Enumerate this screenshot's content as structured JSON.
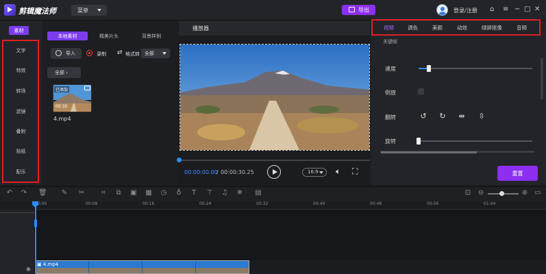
{
  "app": {
    "title": "剪辑魔法师",
    "menu_label": "菜单",
    "export_label": "导出",
    "login_label": "登录/注册"
  },
  "window_controls": {
    "home": "⌂",
    "menu": "≡",
    "minimize": "−",
    "maximize": "□",
    "close": "✕"
  },
  "sidebar": {
    "tag": "素材",
    "items": [
      {
        "label": "文字"
      },
      {
        "label": "特效"
      },
      {
        "label": "转场"
      },
      {
        "label": "滤镜"
      },
      {
        "label": "叠附"
      },
      {
        "label": "贴纸"
      },
      {
        "label": "配乐"
      }
    ]
  },
  "library": {
    "tabs": [
      {
        "label": "本地素材",
        "active": true
      },
      {
        "label": "精美片头",
        "active": false
      },
      {
        "label": "背景样例",
        "active": false
      }
    ],
    "import_label": "导入",
    "record_label": "录制",
    "format_label": "格式转",
    "format_select_value": "全部",
    "filter_label": "全部",
    "media": [
      {
        "badge": "已添加",
        "duration": "00:30",
        "name": "4.mp4"
      }
    ]
  },
  "player": {
    "header": "播放器",
    "current_time": "00:00:00.00",
    "separator": "/",
    "total_time": "00:00:30.25",
    "progress": 0.0,
    "ratio": "16:9"
  },
  "properties": {
    "tabs": [
      {
        "label": "视频",
        "active": true
      },
      {
        "label": "调色",
        "active": false
      },
      {
        "label": "美颜",
        "active": false
      },
      {
        "label": "动效",
        "active": false
      },
      {
        "label": "绿屏抠像",
        "active": false
      },
      {
        "label": "音频",
        "active": false
      }
    ],
    "keyframe_label": "关键帧",
    "speed_label": "速度",
    "speed_level": 0.09,
    "reverse_label": "倒放",
    "flip_label": "翻转",
    "rotate_label": "旋转",
    "rotate_level": 0.0,
    "reset_label": "重置"
  },
  "timeline": {
    "ruler_labels": [
      "00:00",
      "00:08",
      "00:16",
      "00:24",
      "00:32",
      "00:40",
      "00:48",
      "00:56",
      "01:04"
    ],
    "clip_name": "4.mp4",
    "zoom_level": 0.45
  },
  "colors": {
    "accent": "#8c2ff0",
    "tab_active": "#7b3cf0",
    "playback_blue": "#2f8bff",
    "highlight_red": "#e02020"
  }
}
